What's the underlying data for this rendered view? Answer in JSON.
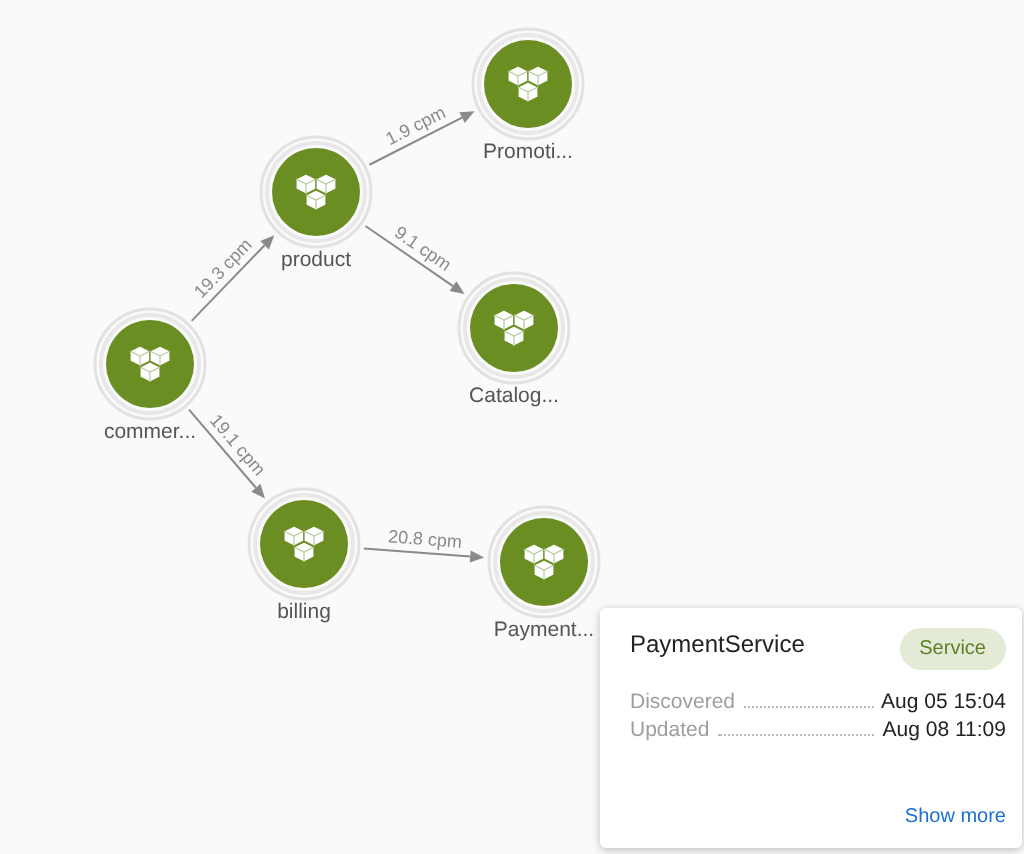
{
  "graph": {
    "nodes": [
      {
        "label": "commer..."
      },
      {
        "label": "product"
      },
      {
        "label": "Promoti..."
      },
      {
        "label": "Catalog..."
      },
      {
        "label": "billing"
      },
      {
        "label": "Payment..."
      }
    ],
    "edges": [
      {
        "label": "19.3 cpm"
      },
      {
        "label": "1.9 cpm"
      },
      {
        "label": "9.1 cpm"
      },
      {
        "label": "19.1 cpm"
      },
      {
        "label": "20.8 cpm"
      }
    ]
  },
  "card": {
    "title": "PaymentService",
    "badge": "Service",
    "rows": [
      {
        "label": "Discovered",
        "value": "Aug 05 15:04"
      },
      {
        "label": "Updated",
        "value": "Aug 08 11:09"
      }
    ],
    "link": "Show more"
  }
}
